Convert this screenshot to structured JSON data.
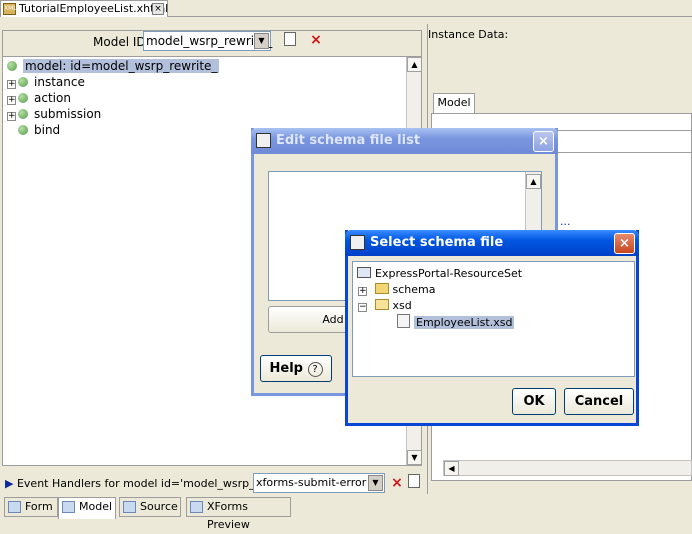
{
  "editor": {
    "tab_title": "TutorialEmployeeList.xhtml",
    "tab_close": "×"
  },
  "model_bar": {
    "label": "Model ID:",
    "selected_model": "model_wsrp_rewrite_"
  },
  "tree": {
    "root": "model: id=model_wsrp_rewrite_",
    "children": [
      "instance",
      "action",
      "submission",
      "bind"
    ]
  },
  "event_bar": {
    "label": "Event Handlers for model id='model_wsrp_re...",
    "selected_event": "xforms-submit-error"
  },
  "bottom_tabs": [
    "Form",
    "Model",
    "Source",
    "XForms Preview"
  ],
  "right_panel": {
    "instance_label": "Instance Data:",
    "model_tab": "Model",
    "link_fragment": "..."
  },
  "edit_schema_dialog": {
    "title": "Edit schema file list",
    "add_button": "Add",
    "help_button": "Help",
    "help_icon": "?"
  },
  "select_schema_dialog": {
    "title": "Select schema file",
    "tree": {
      "root": "ExpressPortal-ResourceSet",
      "folders": [
        {
          "name": "schema",
          "expanded": false
        },
        {
          "name": "xsd",
          "expanded": true,
          "files": [
            "EmployeeList.xsd"
          ]
        }
      ]
    },
    "ok_button": "OK",
    "cancel_button": "Cancel"
  },
  "icons": {
    "close": "×",
    "plus": "+",
    "minus": "−",
    "up": "▲",
    "down": "▼",
    "left": "◀",
    "right": "▶",
    "dropdown": "▼"
  }
}
